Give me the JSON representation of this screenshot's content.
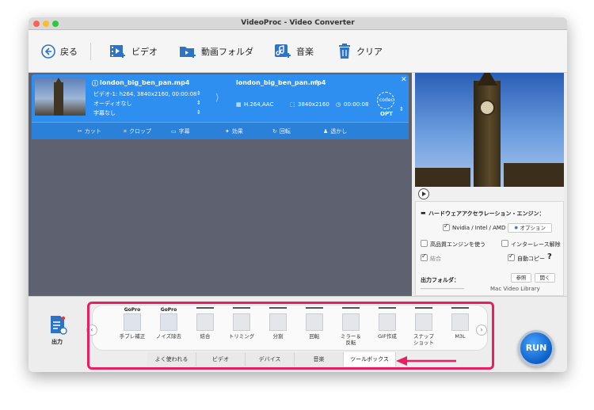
{
  "window": {
    "title": "VideoProc - Video Converter",
    "traffic_lights": [
      "#ff5f57",
      "#febc2e",
      "#28c840"
    ]
  },
  "toolbar": {
    "back": "戻る",
    "video": "ビデオ",
    "folder": "動画フォルダ",
    "music": "音楽",
    "clear": "クリア"
  },
  "file": {
    "source_name": "london_big_ben_pan.mp4",
    "video_info": "ビデオ-1: h264, 3840x2160, 00:00:08",
    "audio_info": "オーディオなし",
    "subtitle_info": "字幕なし",
    "output_name": "london_big_ben_pan.mp4",
    "codec": "H.264,AAC",
    "resolution": "3840x2160",
    "duration": "00:00:08",
    "codec_label": "codec",
    "opt_label": "OPT"
  },
  "edit_bar": {
    "cut": "カット",
    "crop": "クロップ",
    "subtitle": "字幕",
    "effect": "効果",
    "rotate": "回転",
    "watermark": "透かし"
  },
  "settings": {
    "hw_title": "ハードウェアアクセラレーション・エンジン：",
    "nvidia": "Nvidia / Intel / AMD",
    "option": "オプション",
    "hq_engine": "高品質エンジンを使う",
    "deinterlace": "インターレース解除",
    "merge": "結合",
    "auto_copy": "自動コピー",
    "help": "?",
    "output_folder_label": "出力フォルダ：",
    "browse": "参照",
    "open": "開く",
    "output_path": "Mac Video Library"
  },
  "output_button": "出力",
  "formats": [
    {
      "label": "手ブレ補正",
      "gopro": "GoPro"
    },
    {
      "label": "ノイズ除去",
      "gopro": "GoPro"
    },
    {
      "label": "結合",
      "gopro": ""
    },
    {
      "label": "トリミング",
      "gopro": ""
    },
    {
      "label": "分割",
      "gopro": ""
    },
    {
      "label": "回転",
      "gopro": ""
    },
    {
      "label": "ミラー＆反転",
      "gopro": ""
    },
    {
      "label": "GIF作成",
      "gopro": ""
    },
    {
      "label": "スナップショット",
      "gopro": ""
    },
    {
      "label": "M3L",
      "gopro": ""
    }
  ],
  "tabs": [
    "よく使われる",
    "ビデオ",
    "デバイス",
    "音楽",
    "ツールボックス"
  ],
  "active_tab": "ツールボックス",
  "run": "RUN",
  "colors": {
    "accent": "#2f8ff0",
    "highlight": "#e91e63"
  }
}
